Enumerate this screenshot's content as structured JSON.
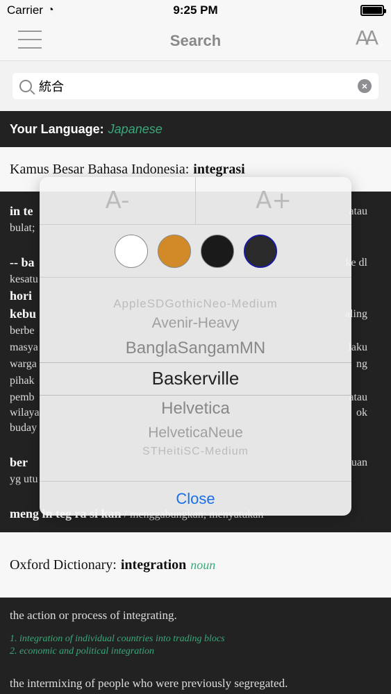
{
  "status_bar": {
    "carrier": "Carrier",
    "time": "9:25 PM"
  },
  "nav": {
    "title": "Search",
    "font_icon": "AA"
  },
  "search": {
    "value": "統合",
    "clear": "×"
  },
  "language": {
    "label": "Your Language:",
    "value": "Japanese"
  },
  "kbbi": {
    "source": "Kamus Besar Bahasa Indonesia:",
    "word": "integrasi",
    "lines": [
      {
        "left": "in te",
        "right": "atau"
      },
      {
        "left": "bulat;",
        "right": ""
      },
      {
        "left": "-- ba",
        "right": "ke dl"
      },
      {
        "left": "kesatu",
        "right": ""
      },
      {
        "left": "hori",
        "right": ""
      },
      {
        "left": "kebu",
        "right": "aling"
      },
      {
        "left": "berbe",
        "right": ""
      },
      {
        "left": "masya",
        "right": "laku"
      },
      {
        "left": "warga",
        "right": "ng"
      },
      {
        "left": "pihak",
        "right": ""
      },
      {
        "left": "pemb",
        "right": "atau"
      },
      {
        "left": "wilaya",
        "right": "ok"
      },
      {
        "left": "buday",
        "right": ""
      },
      {
        "left": "ber",
        "right": "uan"
      },
      {
        "left": "yg utu",
        "right": ""
      }
    ],
    "last_word": "meng in teg ra si kan",
    "last_def": "/ menggabungkan; menyatukan"
  },
  "oxford": {
    "source": "Oxford Dictionary:",
    "word": "integration",
    "pos": "noun",
    "definition1": "the action or process of integrating.",
    "examples": [
      "1. integration of individual countries into trading blocs",
      "2. economic and political integration"
    ],
    "definition2": "the intermixing of people who were previously segregated."
  },
  "popup": {
    "decrease_label": "A-",
    "increase_label": "A+",
    "colors": [
      "#ffffff",
      "#d18a27",
      "#1a1a1a",
      "#2a2a2a"
    ],
    "selected_color_border": "#1a1aa0",
    "fonts": [
      "AppleSDGothicNeo-Medium",
      "Avenir-Heavy",
      "BanglaSangamMN",
      "Baskerville",
      "Helvetica",
      "HelveticaNeue",
      "STHeitiSC-Medium"
    ],
    "selected_font": "Baskerville",
    "close_label": "Close"
  }
}
